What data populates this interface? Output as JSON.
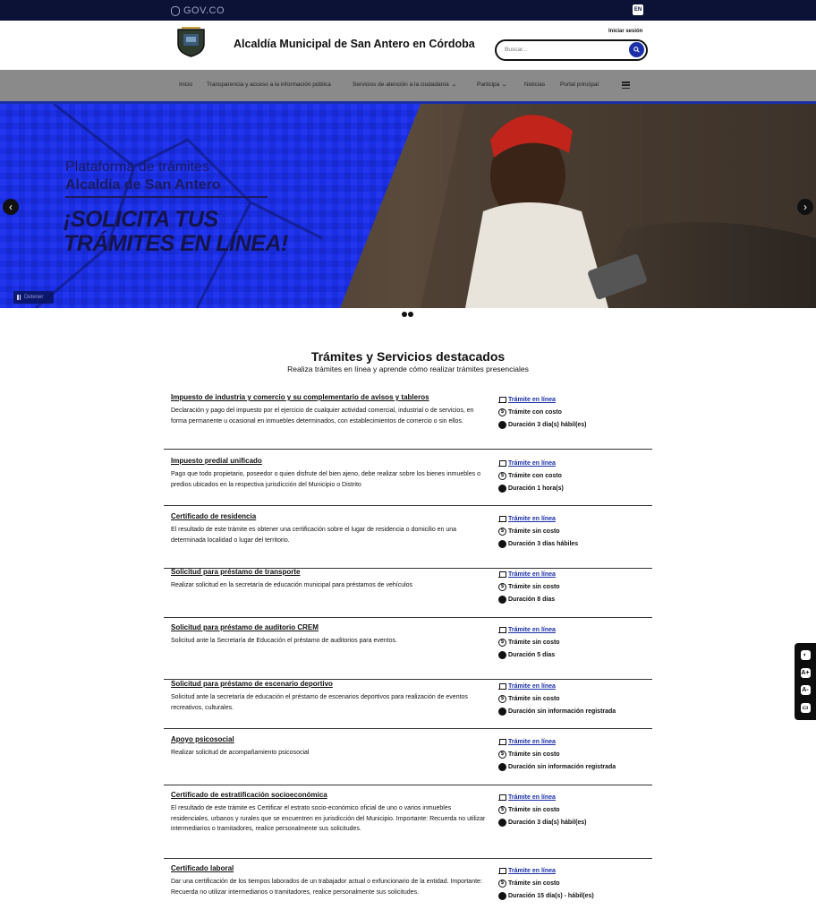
{
  "gov_bar": {
    "logo_text": "GOV.CO",
    "lang_label": "EN"
  },
  "header": {
    "site_title": "Alcaldía Municipal de San Antero en Córdoba",
    "login_label": "Iniciar sesión",
    "search_placeholder": "Buscar...",
    "search_icon": "search-icon"
  },
  "nav": {
    "items": [
      {
        "label": "Inicio",
        "dropdown": false
      },
      {
        "label": "Transparencia y acceso a la información pública",
        "dropdown": false
      },
      {
        "label": "Servicios de atención a la ciudadanía",
        "dropdown": true
      },
      {
        "label": "Participa",
        "dropdown": true
      },
      {
        "label": "Noticias",
        "dropdown": false
      },
      {
        "label": "Portal principal",
        "dropdown": false
      }
    ],
    "menu_icon": "hamburger-icon"
  },
  "hero": {
    "subtitle": "Plataforma de trámites",
    "subtitle2": "Alcaldía de San Antero",
    "headline_line1": "¡SOLICITA TUS",
    "headline_line2": "TRÁMITES EN LÍNEA!",
    "pause_label": "Detener",
    "accent_color": "#1a2fe8"
  },
  "section": {
    "title": "Trámites y Servicios destacados",
    "subtitle": "Realiza trámites en línea y aprende cómo realizar trámites presenciales"
  },
  "services": [
    {
      "name": "Impuesto de industria y comercio y su complementario de avisos y tableros",
      "desc": "Declaración y pago del impuesto por el ejercicio de cualquier actividad comercial, industrial o de servicios, en forma permanente u ocasional en inmuebles determinados, con establecimientos de comercio o sin ellos.",
      "online": "Trámite en línea",
      "cost": "Trámite con costo",
      "duration": "Duración 3 día(s) hábil(es)"
    },
    {
      "name": "Impuesto predial unificado",
      "desc": "Pago que todo propietario, poseedor o quien disfrute del bien ajeno, debe realizar sobre los bienes inmuebles o predios ubicados en la respectiva jurisdicción del Municipio o Distrito",
      "online": "Trámite en línea",
      "cost": "Trámite con costo",
      "duration": "Duración 1 hora(s)"
    },
    {
      "name": "Certificado de residencia",
      "desc": "El resultado de este trámite es obtener una certificación sobre el lugar de residencia o domicilio en una determinada localidad o lugar del territorio.",
      "online": "Trámite en línea",
      "cost": "Trámite sin costo",
      "duration": "Duración 3 días hábiles"
    },
    {
      "name": "Solicitud para préstamo de transporte",
      "desc": "Realizar solicitud en la secretaría de educación municipal para préstamos de vehículos",
      "online": "Trámite en línea",
      "cost": "Trámite sin costo",
      "duration": "Duración 8 días"
    },
    {
      "name": "Solicitud para préstamo de auditorio CREM",
      "desc": "Solicitud ante la Secretaría de Educación el préstamo de auditorios para eventos.",
      "online": "Trámite en línea",
      "cost": "Trámite sin costo",
      "duration": "Duración 5 días"
    },
    {
      "name": "Solicitud para préstamo de escenario deportivo",
      "desc": "Solicitud ante la secretaría de educación el préstamo de escenarios deportivos para realización de eventos recreativos, culturales.",
      "online": "Trámite en línea",
      "cost": "Trámite sin costo",
      "duration": "Duración sin información registrada"
    },
    {
      "name": "Apoyo psicosocial",
      "desc": "Realizar solicitud de acompañamiento psicosocial",
      "online": "Trámite en línea",
      "cost": "Trámite sin costo",
      "duration": "Duración sin información registrada"
    },
    {
      "name": "Certificado de estratificación socioeconómica",
      "desc": "El resultado de este trámite es Certificar el estrato socio-económico oficial de uno o varios inmuebles residenciales, urbanos y rurales que se encuentren en jurisdicción del Municipio. Importante: Recuerda no utilizar intermediarios o tramitadores, realice personalmente sus solicitudes.",
      "online": "Trámite en línea",
      "cost": "Trámite sin costo",
      "duration": "Duración 3 día(s) hábil(es)"
    },
    {
      "name": "Certificado laboral",
      "desc": "Dar una certificación de los tiempos laborados de un trabajador actual o exfuncionario de la entidad. Importante: Recuerda no utilizar intermediarios o tramitadores, realice personalmente sus solicitudes.",
      "online": "Trámite en línea",
      "cost": "Trámite sin costo",
      "duration": "Duración 15 día(s) - hábil(es)"
    }
  ],
  "float_tools": [
    "contrast-icon",
    "text-increase-icon",
    "text-decrease-icon",
    "chat-icon"
  ]
}
